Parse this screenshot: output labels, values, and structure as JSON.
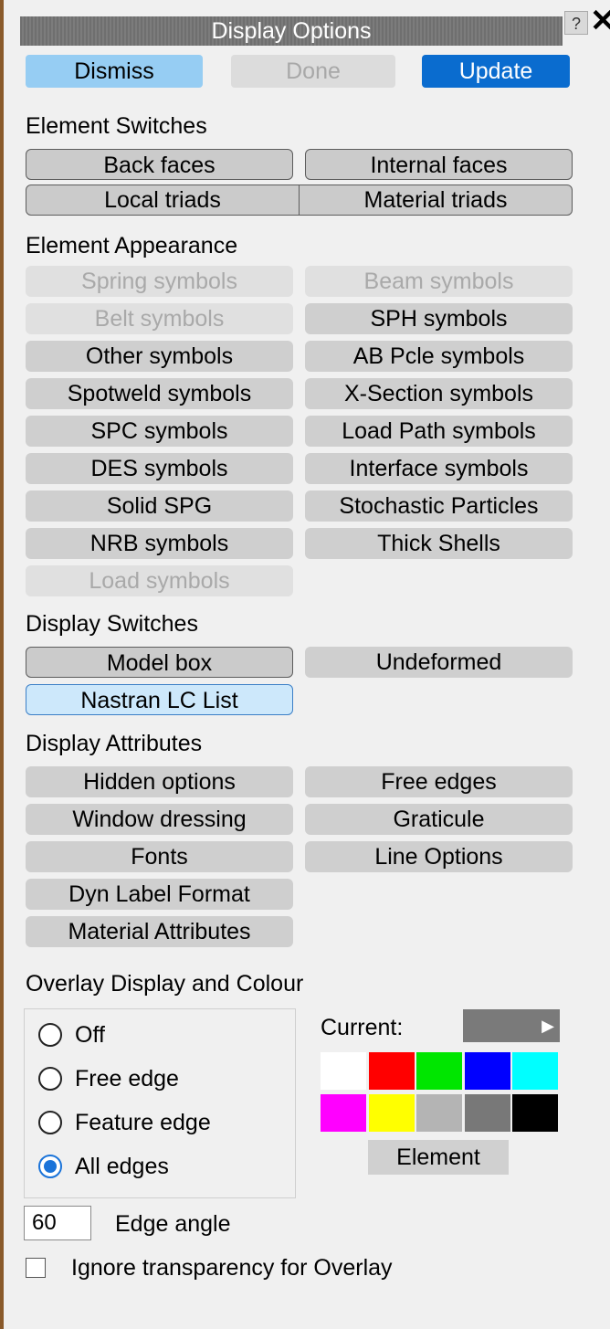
{
  "title": "Display Options",
  "help_glyph": "?",
  "close_glyph": "✕",
  "actions": {
    "dismiss": "Dismiss",
    "done": "Done",
    "update": "Update"
  },
  "element_switches": {
    "heading": "Element Switches",
    "back_faces": "Back faces",
    "internal_faces": "Internal faces",
    "local_triads": "Local triads",
    "material_triads": "Material triads"
  },
  "element_appearance": {
    "heading": "Element Appearance",
    "items": [
      {
        "label": "Spring symbols",
        "state": "disabled"
      },
      {
        "label": "Beam symbols",
        "state": "disabled"
      },
      {
        "label": "Belt symbols",
        "state": "disabled"
      },
      {
        "label": "SPH symbols",
        "state": "normal"
      },
      {
        "label": "Other symbols",
        "state": "normal"
      },
      {
        "label": "AB Pcle symbols",
        "state": "normal"
      },
      {
        "label": "Spotweld symbols",
        "state": "normal"
      },
      {
        "label": "X-Section symbols",
        "state": "normal"
      },
      {
        "label": "SPC symbols",
        "state": "normal"
      },
      {
        "label": "Load Path symbols",
        "state": "normal"
      },
      {
        "label": "DES symbols",
        "state": "normal"
      },
      {
        "label": "Interface symbols",
        "state": "normal"
      },
      {
        "label": "Solid SPG",
        "state": "normal"
      },
      {
        "label": "Stochastic Particles",
        "state": "normal"
      },
      {
        "label": "NRB symbols",
        "state": "normal"
      },
      {
        "label": "Thick Shells",
        "state": "normal"
      },
      {
        "label": "Load symbols",
        "state": "disabled"
      }
    ]
  },
  "display_switches": {
    "heading": "Display Switches",
    "model_box": "Model box",
    "undeformed": "Undeformed",
    "nastran_lc_list": "Nastran LC List"
  },
  "display_attributes": {
    "heading": "Display Attributes",
    "hidden_options": "Hidden options",
    "free_edges": "Free edges",
    "window_dressing": "Window dressing",
    "graticule": "Graticule",
    "fonts": "Fonts",
    "line_options": "Line Options",
    "dyn_label_format": "Dyn Label Format",
    "material_attributes": "Material Attributes"
  },
  "overlay": {
    "heading": "Overlay Display and Colour",
    "options": [
      "Off",
      "Free edge",
      "Feature edge",
      "All edges"
    ],
    "selected": "All edges",
    "current_label": "Current:",
    "current_color": "#7a7a7a",
    "palette": [
      "#ffffff",
      "#ff0000",
      "#00e600",
      "#0000ff",
      "#00ffff",
      "#ff00ff",
      "#ffff00",
      "#b4b4b4",
      "#787878",
      "#000000"
    ],
    "element_button": "Element"
  },
  "edge_angle": {
    "value": "60",
    "label": "Edge angle"
  },
  "ignore_transparency": {
    "label": "Ignore transparency for Overlay",
    "checked": false
  }
}
